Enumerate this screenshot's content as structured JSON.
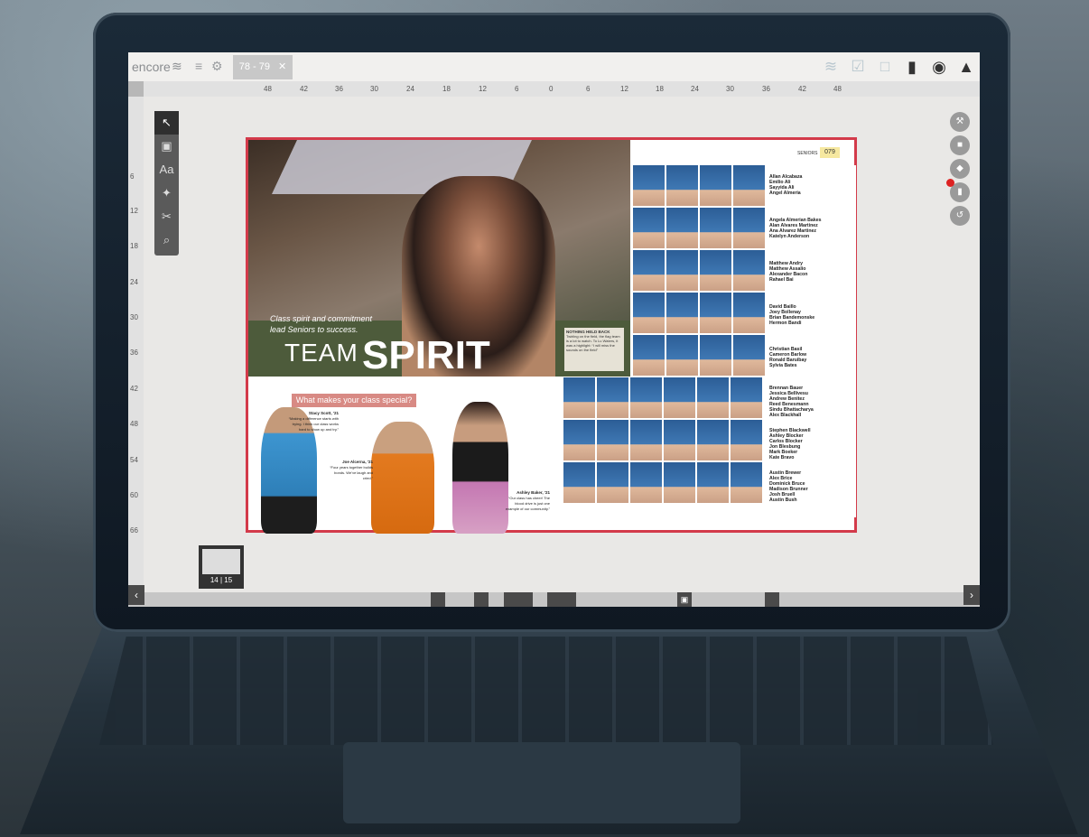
{
  "app": {
    "brand": "encore",
    "tab_label": "78 - 79",
    "tab_close": "✕"
  },
  "ruler": {
    "h_ticks": [
      "48",
      "42",
      "36",
      "30",
      "24",
      "18",
      "12",
      "6",
      "0",
      "6",
      "12",
      "18",
      "24",
      "30",
      "36",
      "42",
      "48"
    ],
    "v_ticks": [
      "6",
      "12",
      "18",
      "24",
      "30",
      "36",
      "42",
      "48",
      "54",
      "60",
      "66"
    ]
  },
  "tools": [
    "↖",
    "▣",
    "Aa",
    "✦",
    "✂",
    "⌕"
  ],
  "spread": {
    "caption": "Class spirit and commitment lead Seniors to success.",
    "headline_light": "TEAM",
    "headline_bold": "SPIRIT",
    "sidebar_title": "NOTHING HELD BACK",
    "sidebar_text": "Twirling on the field, the flag team is a lot to watch. To Lu Waters, it was a highlight: “I will miss the sounds on the field”",
    "section_question": "What makes your class special?",
    "quotes": [
      {
        "name": "Stacy Scott, '21",
        "text": "“Making a difference starts with trying. I think our class works hard to show up and try.”"
      },
      {
        "name": "Joe Alcerna, '21",
        "text": "“Four years together builds bonds. We’ve laugh and cried.”"
      },
      {
        "name": "Ashley Baker, '21",
        "text": "“Our class has cheer! The blood drive is just one example of our community.”"
      }
    ],
    "section_tag": "SENIORS",
    "page_number": "079",
    "name_groups": [
      [
        "Allan Alcabaza",
        "Emilio Ali",
        "Sayyida Ali",
        "Angel Almeria"
      ],
      [
        "Angela Almerian Bakes",
        "Alan Alvares Martinez",
        "Ana Alvarez Martinez",
        "Katelyn Anderson"
      ],
      [
        "Matthew Andry",
        "Matthew Assalio",
        "Alexander Bacon",
        "Rahael Bai"
      ],
      [
        "David Baillo",
        "Joey Bollenay",
        "Brian Bandemonske",
        "Hermon Bandi"
      ],
      [
        "Christian Basil",
        "Cameron Barlow",
        "Ronald Baruibay",
        "Sylvia Bates"
      ],
      [
        "Brennan Bauer",
        "Jessica Bellivesu",
        "Andrew Benitez",
        "Reed Benesmann",
        "Sindu Bhattacharya",
        "Alex Blackhall"
      ],
      [
        "Stephen Blackwell",
        "Ashley Blocker",
        "Carlos Blocker",
        "Jon Blesbung",
        "Mark Boeker",
        "Kate Bravo"
      ],
      [
        "Austin Brewer",
        "Alex Brice",
        "Dominick Bruce",
        "Madison Brunner",
        "Josh Bruell",
        "Austin Bush"
      ]
    ]
  },
  "thumbnail": {
    "label": "14 | 15"
  },
  "nav": {
    "prev": "‹",
    "next": "›",
    "lock": "▣"
  }
}
